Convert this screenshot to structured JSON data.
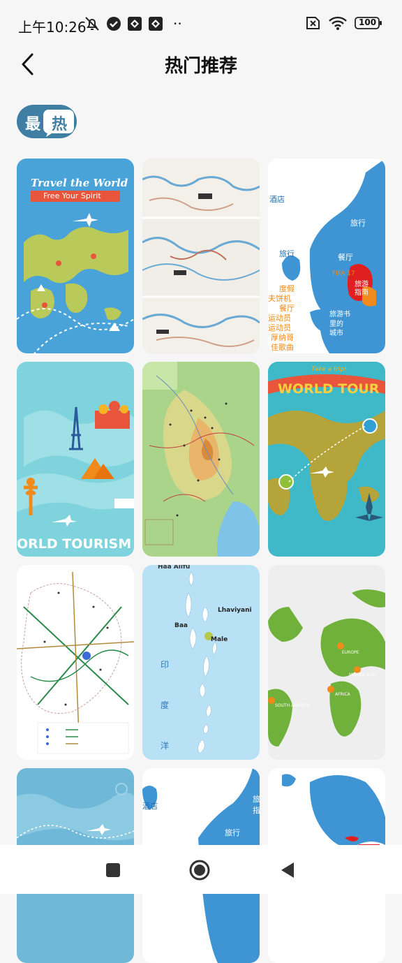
{
  "status_bar": {
    "time": "上午10:26",
    "dots": "··",
    "battery": "100"
  },
  "header": {
    "title": "热门推荐"
  },
  "badge": {
    "left_char": "最",
    "right_char": "热"
  },
  "cards": {
    "c1_title": "Travel the World",
    "c1_subtitle": "Free Your Spirit",
    "c3_l1": "旅行",
    "c3_l2": "餐厅",
    "c3_l3": "度假",
    "c3_l4": "旅游指南",
    "c3_l5": "FIFA 17",
    "c3_l6": "旅游书",
    "c3_l7": "里的",
    "c3_l8": "城市",
    "c3_l9": "酒店",
    "c3_l10": "厚纳哥",
    "c3_l11": "佳歌曲",
    "c3_l12": "运动员",
    "c3_l13": "夫饼机",
    "c4_text": "ORLD TOURISM D",
    "c6_tag": "Take a trip!",
    "c6_title": "WORLD TOUR",
    "c8_top": "Haa Alifu",
    "c8_a": "Lhaviyani",
    "c8_b": "Baa",
    "c8_c": "Male",
    "c8_d": "印",
    "c8_e": "度",
    "c8_f": "洋",
    "c9_a": "EUROPE",
    "c9_b": "MIDDLE EAST",
    "c9_c": "AFRICA",
    "c9_d": "SOUTH AMERICA",
    "c11_l1": "酒店",
    "c11_l2": "旅行",
    "c11_l3": "旅",
    "c11_l4": "指"
  },
  "colors": {
    "badge_bg": "#3f7fa3",
    "ocean": "#4aa3d8",
    "land_green": "#b9c95a",
    "map_red": "#e02020"
  }
}
